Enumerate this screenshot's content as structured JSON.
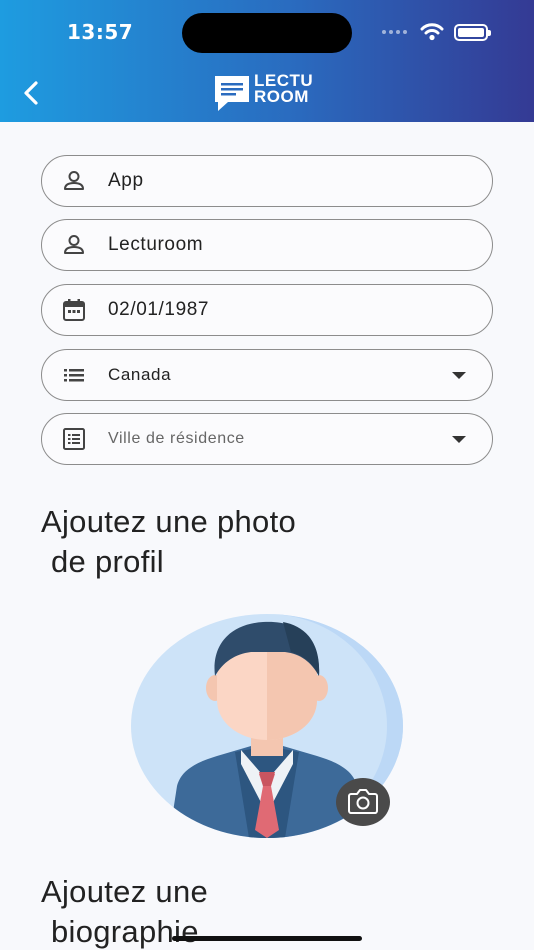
{
  "status_bar": {
    "time": "13:57"
  },
  "header": {
    "logo_line1": "LECTU",
    "logo_line2": "ROOM",
    "back_icon": "chevron-left-icon"
  },
  "form": {
    "first_name": {
      "value": "App",
      "icon": "person-icon"
    },
    "last_name": {
      "value": "Lecturoom",
      "icon": "person-icon"
    },
    "birth_date": {
      "value": "02/01/1987",
      "icon": "calendar-icon"
    },
    "country": {
      "value": "Canada",
      "icon": "list-icon"
    },
    "city": {
      "placeholder": "Ville de résidence",
      "icon": "list-alt-icon"
    }
  },
  "photo_section": {
    "title_line1": "Ajoutez une photo",
    "title_line2": "de profil",
    "camera_icon": "camera-icon"
  },
  "bio_section": {
    "title_line1": "Ajoutez une",
    "title_line2": "biographie"
  },
  "colors": {
    "header_start": "#1e9ce0",
    "header_end": "#343a94",
    "field_border": "#8c8c8c",
    "background": "#f8f9fc"
  }
}
